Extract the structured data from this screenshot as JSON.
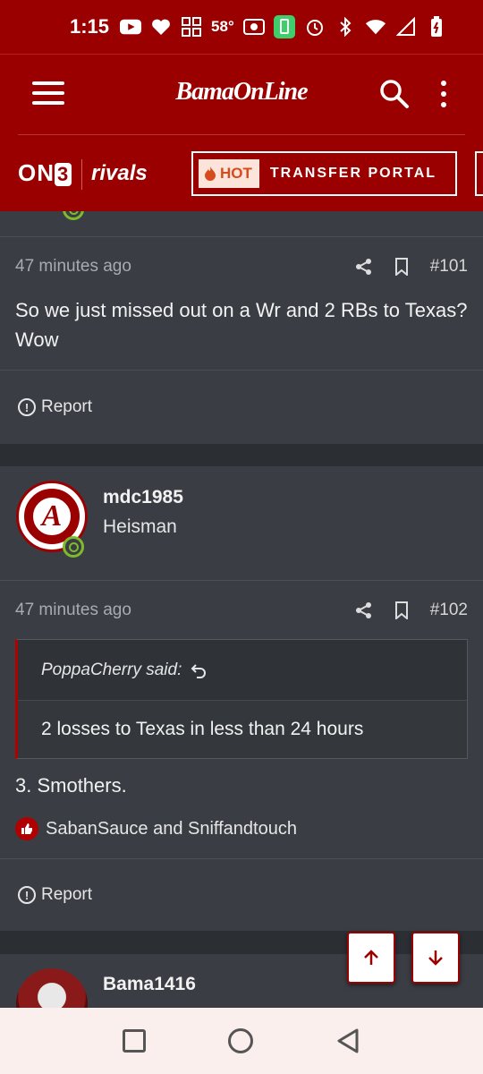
{
  "status_bar": {
    "time": "1:15",
    "temperature": "58°"
  },
  "header": {
    "logo": "BamaOnLine"
  },
  "subheader": {
    "brand_on3": "ON",
    "brand_on3_num": "3",
    "brand_rivals": "rivals",
    "hot_label": "HOT",
    "portal_label": "TRANSFER PORTAL"
  },
  "posts": [
    {
      "time": "47 minutes ago",
      "number": "#101",
      "text": "So we just missed out on a Wr and 2 RBs to Texas? Wow",
      "report_label": "Report"
    },
    {
      "author": "mdc1985",
      "title": "Heisman",
      "time": "47 minutes ago",
      "number": "#102",
      "quote_author": "PoppaCherry said:",
      "quote_text": "2 losses to Texas in less than 24 hours",
      "text": "3. Smothers.",
      "likes": "SabanSauce and Sniffandtouch",
      "report_label": "Report"
    },
    {
      "author": "Bama1416"
    }
  ],
  "colors": {
    "brand": "#9b0000",
    "background": "#2b2e33",
    "card": "#3a3d43"
  }
}
